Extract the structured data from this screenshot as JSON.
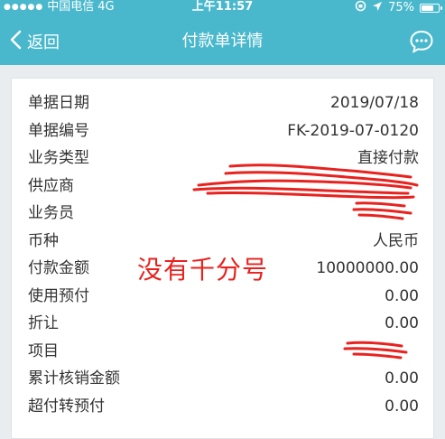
{
  "status": {
    "carrier": "中国电信",
    "network": "4G",
    "time": "上午11:57",
    "battery_text": "75%",
    "battery_level": 0.75
  },
  "nav": {
    "back_label": "返回",
    "title": "付款单详情"
  },
  "rows": [
    {
      "label": "单据日期",
      "value": "2019/07/18"
    },
    {
      "label": "单据编号",
      "value": "FK-2019-07-0120"
    },
    {
      "label": "业务类型",
      "value": "直接付款"
    },
    {
      "label": "供应商",
      "value": ""
    },
    {
      "label": "业务员",
      "value": ""
    },
    {
      "label": "币种",
      "value": "人民币"
    },
    {
      "label": "付款金额",
      "value": "10000000.00"
    },
    {
      "label": "使用预付",
      "value": "0.00"
    },
    {
      "label": "折让",
      "value": "0.00"
    },
    {
      "label": "项目",
      "value": ""
    },
    {
      "label": "累计核销金额",
      "value": "0.00"
    },
    {
      "label": "超付转预付",
      "value": "0.00"
    }
  ],
  "annotation": "没有千分号",
  "colors": {
    "header": "#49b8cc",
    "annotation": "#e8221e",
    "link": "#3478c6"
  }
}
